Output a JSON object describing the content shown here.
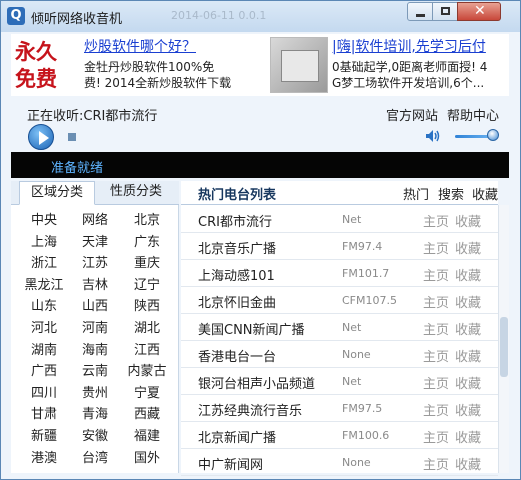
{
  "window": {
    "title": "倾听网络收音机",
    "faded_title": "2014-06-11  0.0.1",
    "icon": "app-q-icon"
  },
  "ads": {
    "left": {
      "big_text": [
        "永久",
        "免费"
      ],
      "title": "炒股软件哪个好？",
      "lines": [
        "金牡丹炒股软件100%免",
        "费!    2014全新炒股软件下载"
      ]
    },
    "right": {
      "title": "|嗨|软件培训,先学习后付",
      "lines": [
        "0基础起学,0距离老师面授! 4",
        "G梦工场软件开发培训,6个..."
      ]
    }
  },
  "player": {
    "now_playing_label": "正在收听:CRI都市流行",
    "official_site": "官方网站",
    "help_center": "帮助中心",
    "status": "准备就绪",
    "volume_level": 0.8
  },
  "left_panel": {
    "tabs": [
      "区域分类",
      "性质分类"
    ],
    "regions": [
      [
        "中央",
        "网络",
        "北京"
      ],
      [
        "上海",
        "天津",
        "广东"
      ],
      [
        "浙江",
        "江苏",
        "重庆"
      ],
      [
        "黑龙江",
        "吉林",
        "辽宁"
      ],
      [
        "山东",
        "山西",
        "陕西"
      ],
      [
        "河北",
        "河南",
        "湖北"
      ],
      [
        "湖南",
        "海南",
        "江西"
      ],
      [
        "广西",
        "云南",
        "内蒙古"
      ],
      [
        "四川",
        "贵州",
        "宁夏"
      ],
      [
        "甘肃",
        "青海",
        "西藏"
      ],
      [
        "新疆",
        "安徽",
        "福建"
      ],
      [
        "港澳",
        "台湾",
        "国外"
      ]
    ]
  },
  "right_panel": {
    "title": "热门电台列表",
    "header_links": [
      "热门",
      "搜索",
      "收藏"
    ],
    "row_home": "主页",
    "row_fav": "收藏",
    "stations": [
      {
        "name": "CRI都市流行",
        "freq": "Net"
      },
      {
        "name": "北京音乐广播",
        "freq": "FM97.4"
      },
      {
        "name": "上海动感101",
        "freq": "FM101.7"
      },
      {
        "name": "北京怀旧金曲",
        "freq": "CFM107.5"
      },
      {
        "name": "美国CNN新闻广播",
        "freq": "Net"
      },
      {
        "name": "香港电台一台",
        "freq": "None"
      },
      {
        "name": "银河台相声小品频道",
        "freq": "Net"
      },
      {
        "name": "江苏经典流行音乐",
        "freq": "FM97.5"
      },
      {
        "name": "北京新闻广播",
        "freq": "FM100.6"
      },
      {
        "name": "中广新闻网",
        "freq": "None"
      }
    ]
  }
}
